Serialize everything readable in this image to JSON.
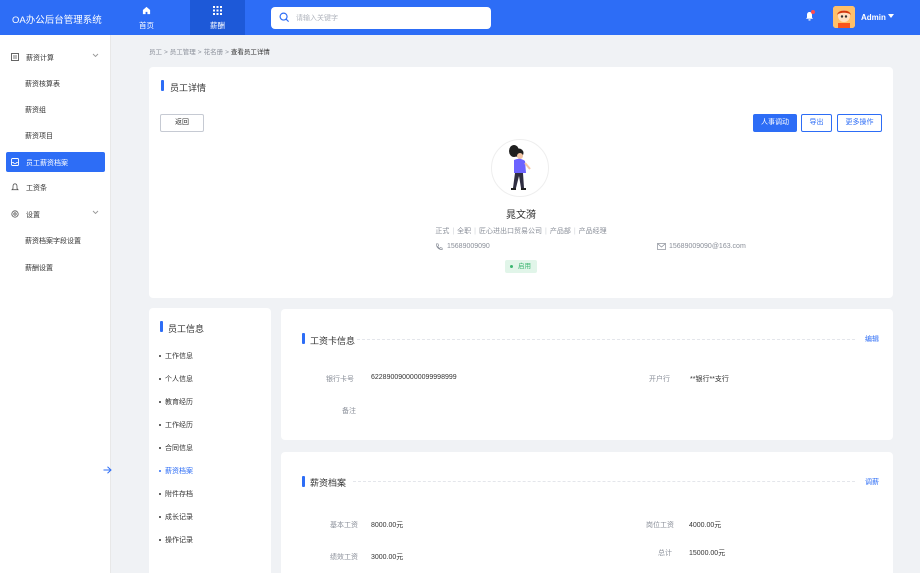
{
  "app": {
    "title": "OA办公后台管理系统"
  },
  "topnav": [
    {
      "label": "首页",
      "icon": "home-icon"
    },
    {
      "label": "薪酬",
      "icon": "grid-icon"
    }
  ],
  "search": {
    "placeholder": "请输入关键字"
  },
  "user": {
    "name": "Admin"
  },
  "sidebar": {
    "items": [
      {
        "label": "薪资计算",
        "icon": "document-icon"
      },
      {
        "label": "薪资核算表"
      },
      {
        "label": "薪资组"
      },
      {
        "label": "薪资项目"
      },
      {
        "label": "员工薪资档案",
        "icon": "inbox-icon"
      },
      {
        "label": "工资条",
        "icon": "bell-icon"
      },
      {
        "label": "设置",
        "icon": "gear-icon"
      },
      {
        "label": "薪资档案字段设置"
      },
      {
        "label": "薪酬设置"
      }
    ]
  },
  "breadcrumb": [
    "员工",
    ">",
    "员工管理",
    ">",
    "花名册",
    ">",
    "查看员工详情"
  ],
  "detail": {
    "title": "员工详情",
    "back_label": "返回",
    "transfer_label": "人事调动",
    "export_label": "导出",
    "more_label": "更多操作",
    "name": "晁文漪",
    "meta": [
      "正式",
      "全职",
      "匠心进出口贸易公司",
      "产品部",
      "产品经理"
    ],
    "phone": "15689009090",
    "email": "15689009090@163.com",
    "status": "启用"
  },
  "info_nav": {
    "title": "员工信息",
    "items": [
      "工作信息",
      "个人信息",
      "教育经历",
      "工作经历",
      "合同信息",
      "薪资档案",
      "附件存档",
      "成长记录",
      "操作记录"
    ],
    "active_index": 5
  },
  "salary_card": {
    "title": "工资卡信息",
    "edit_label": "编辑",
    "bank_card_label": "银行卡号",
    "bank_card_value": "6228900900000099998999",
    "bank_label": "开户行",
    "bank_value": "**银行**支行",
    "remark_label": "备注",
    "remark_value": ""
  },
  "salary_file": {
    "title": "薪资档案",
    "adjust_label": "调薪",
    "base_label": "基本工资",
    "base_value": "8000.00元",
    "post_label": "岗位工资",
    "post_value": "4000.00元",
    "perf_label": "绩效工资",
    "perf_value": "3000.00元",
    "total_label": "总计",
    "total_value": "15000.00元"
  },
  "colors": {
    "primary": "#2d6df6",
    "success": "#3ab56f"
  }
}
